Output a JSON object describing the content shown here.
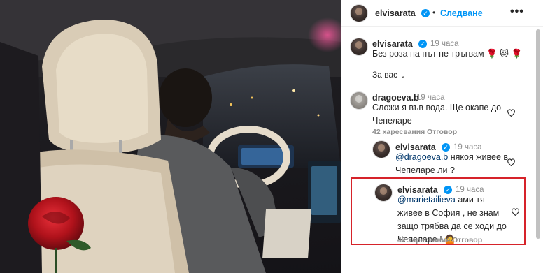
{
  "header": {
    "username": "elvisarata",
    "separator": "•",
    "follow_label": "Следване",
    "more_label": "•••"
  },
  "caption": {
    "username": "elvisarata",
    "time": "19 часа",
    "text": "Без роза на път не тръгвам 🌹 😻 🌹"
  },
  "sort": {
    "label": "За вас"
  },
  "comments": [
    {
      "username": "dragoeva.b",
      "time": "19 часа",
      "text": "Сложи я във вода. Ще окапе до Чепеларе",
      "likes": "42 харесвания",
      "reply_label": "Отговор"
    },
    {
      "username": "elvisarata",
      "time": "19 часа",
      "mention": "@dragoeva.b",
      "text": " някоя живее в Чепеларе ли ?"
    },
    {
      "username": "elvisarata",
      "time": "19 часа",
      "mention": "@marietailieva",
      "text": " ами тя живее в София , не знам защо трябва да се ходи до Чепеларе ! 🤷",
      "likes": "47 харесвания",
      "reply_label": "Отговор"
    }
  ],
  "colors": {
    "accent": "#0095f6",
    "highlight_border": "#d6232a",
    "rose": "#c8141c"
  }
}
